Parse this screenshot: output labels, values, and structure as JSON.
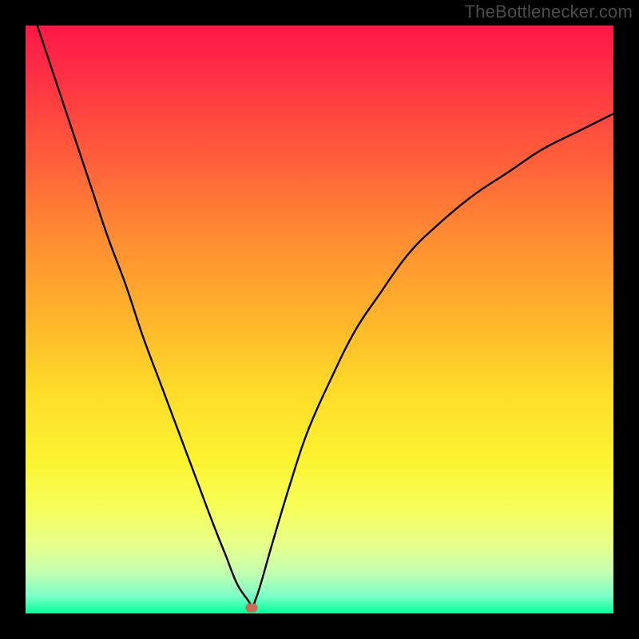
{
  "watermark": "TheBottlenecker.com",
  "chart_data": {
    "type": "line",
    "title": "",
    "xlabel": "",
    "ylabel": "",
    "xlim": [
      0,
      100
    ],
    "ylim": [
      0,
      100
    ],
    "legend": false,
    "grid": false,
    "background_gradient_stops": [
      {
        "pct": 0,
        "color": "#ff1845"
      },
      {
        "pct": 8,
        "color": "#ff2e45"
      },
      {
        "pct": 22,
        "color": "#ff5c3b"
      },
      {
        "pct": 36,
        "color": "#ff8c32"
      },
      {
        "pct": 50,
        "color": "#ffb52b"
      },
      {
        "pct": 62,
        "color": "#ffdb29"
      },
      {
        "pct": 74,
        "color": "#fdf330"
      },
      {
        "pct": 82,
        "color": "#f6ff59"
      },
      {
        "pct": 88,
        "color": "#e9ff88"
      },
      {
        "pct": 93,
        "color": "#c4ffb0"
      },
      {
        "pct": 97,
        "color": "#7dffc7"
      },
      {
        "pct": 100,
        "color": "#00ff9a"
      }
    ],
    "series": [
      {
        "name": "bottleneck-curve",
        "color": "#000000",
        "x": [
          2,
          5,
          8,
          11,
          14,
          17,
          20,
          23,
          26,
          29,
          32,
          34,
          36,
          38,
          38.5,
          39,
          40,
          42,
          45,
          48,
          52,
          56,
          60,
          65,
          70,
          76,
          82,
          88,
          94,
          100
        ],
        "y": [
          100,
          91,
          82,
          73,
          64,
          56,
          47,
          39,
          31,
          23,
          15,
          10,
          5,
          2,
          1,
          2,
          5,
          12,
          22,
          31,
          40,
          48,
          54,
          61,
          66,
          71,
          75,
          79,
          82,
          85
        ]
      }
    ],
    "marker": {
      "x": 38.5,
      "y": 1,
      "color": "#cd6a57"
    },
    "annotations": []
  }
}
